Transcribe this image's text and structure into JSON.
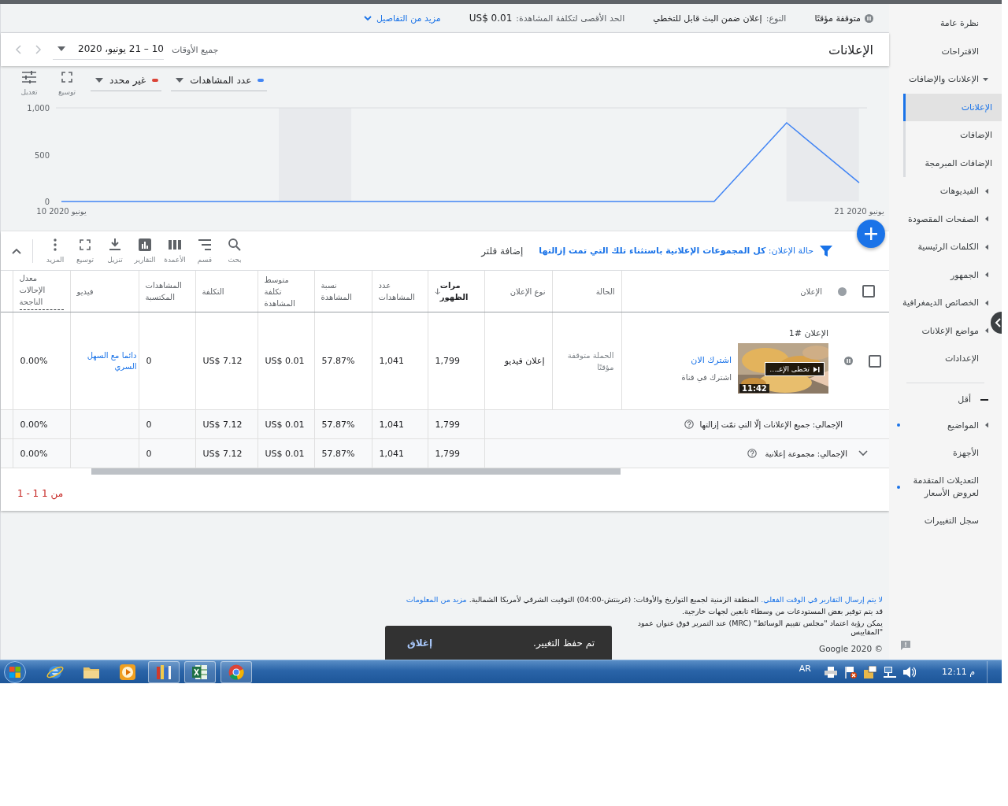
{
  "summary_bar": {
    "paused": true,
    "status": "متوقفة مؤقتًا",
    "type_label": "النوع:",
    "type_value": "إعلان ضمن البث قابل للتخطي",
    "max_cpv_label": "الحد الأقصى لتكلفة المشاهدة:",
    "max_cpv_value": "US$ 0.01",
    "more_details": "مزيد من التفاصيل"
  },
  "page_title": "الإعلانات",
  "date_range": {
    "label": "جميع الأوقات",
    "value": "10 – 21 يونيو، 2020"
  },
  "chart": {
    "metric_selectors": [
      {
        "label": "عدد المشاهدات",
        "color": "#4285f4"
      },
      {
        "label": "غير محدد",
        "color": "#db4437"
      }
    ],
    "tools": [
      {
        "kind": "expand",
        "label": "توسيع"
      },
      {
        "kind": "adjust",
        "label": "تعديل"
      }
    ],
    "chart_data": {
      "type": "line",
      "categories": [
        "10 يونيو 2020",
        null,
        null,
        null,
        null,
        null,
        null,
        null,
        null,
        null,
        null,
        "21 يونيو 2020"
      ],
      "series": [
        {
          "color": "#4285f4",
          "values": [
            0,
            0,
            0,
            0,
            0,
            0,
            0,
            0,
            0,
            0,
            840,
            200
          ]
        }
      ],
      "ylim": [
        0,
        1000
      ],
      "yticks": [
        {
          "value": 0,
          "label": "0"
        },
        {
          "value": 500,
          "label": "500"
        },
        {
          "value": 1000,
          "label": "1,000"
        }
      ]
    }
  },
  "filter_bar": {
    "label": "حالة الإعلان:",
    "value": "كل المجموعات الإعلانية باستثناء تلك التي تمت إزالتها",
    "add_filter": "إضافة فلتر"
  },
  "table_tools": [
    {
      "kind": "search",
      "label": "بحث"
    },
    {
      "kind": "segment",
      "label": "قسم"
    },
    {
      "kind": "columns",
      "label": "الأعمدة"
    },
    {
      "kind": "reports",
      "label": "التقارير"
    },
    {
      "kind": "download",
      "label": "تنزيل"
    },
    {
      "kind": "expand",
      "label": "توسيع"
    },
    {
      "kind": "more",
      "label": "المزيد"
    }
  ],
  "table": {
    "select_all_checked": false,
    "columns": [
      {
        "label": "الإعلان",
        "sorted": false,
        "underlined": false
      },
      {
        "label": "الحالة",
        "sorted": false,
        "underlined": false
      },
      {
        "label": "نوع الإعلان",
        "sorted": false,
        "underlined": false
      },
      {
        "label": "مرات الظهور",
        "sorted": true,
        "underlined": false
      },
      {
        "label": "عدد المشاهدات",
        "sorted": false,
        "underlined": false
      },
      {
        "label": "نسبة المشاهدة",
        "sorted": false,
        "underlined": false
      },
      {
        "label": "متوسط تكلفة المشاهدة",
        "sorted": false,
        "underlined": false
      },
      {
        "label": "التكلفة",
        "sorted": false,
        "underlined": false
      },
      {
        "label": "المشاهدات المكتسبة",
        "sorted": false,
        "underlined": false
      },
      {
        "label": "فيديو",
        "sorted": false,
        "underlined": false
      },
      {
        "label": "معدل الإحالات الناجحة",
        "sorted": false,
        "underlined": true
      }
    ],
    "rows": [
      {
        "checked": false,
        "paused": true,
        "name": "الإعلان #1",
        "video_title": "تخطى الإعـ…",
        "duration": "11:42",
        "headline": "اشترك الان",
        "description": "اشترك في قناة",
        "status": "الحملة متوقفة مؤقتًا",
        "ad_type": "إعلان فيديو",
        "impressions": "1,799",
        "views": "1,041",
        "view_rate": "57.87%",
        "avg_cpv": "US$ 0.01",
        "cost": "US$ 7.12",
        "earned_views": "0",
        "video": "دائما مع السهل السري",
        "conversion_rate": "0.00%"
      }
    ],
    "totals": [
      {
        "label": "الإجمالي: جميع الإعلانات إلّا التي تمّت إزالتها",
        "expandable": false,
        "impressions": "1,799",
        "views": "1,041",
        "view_rate": "57.87%",
        "avg_cpv": "US$ 0.01",
        "cost": "US$ 7.12",
        "earned_views": "0",
        "conversion_rate": "0.00%"
      },
      {
        "label": "الإجمالي: مجموعة إعلانية",
        "expandable": true,
        "impressions": "1,799",
        "views": "1,041",
        "view_rate": "57.87%",
        "avg_cpv": "US$ 0.01",
        "cost": "US$ 7.12",
        "earned_views": "0",
        "conversion_rate": "0.00%"
      }
    ],
    "pagination": "1 - 1 من 1"
  },
  "footer": {
    "notes": [
      {
        "parts": [
          {
            "text": "لا يتم إرسال التقارير في الوقت الفعلي.",
            "link": true
          },
          {
            "text": " المنطقة الزمنية لجميع التواريخ والأوقات: (غرينتش-04:00) التوقيت الشرقي لأمريكا الشمالية. ",
            "link": false
          },
          {
            "text": "مزيد من المعلومات",
            "link": true
          }
        ]
      },
      {
        "parts": [
          {
            "text": "قد يتم توفير بعض المستودعات من وسطاء تابعين لجهات خارجية.",
            "link": false
          }
        ]
      },
      {
        "parts": [
          {
            "text": "يمكن رؤية اعتماد \"مجلس تقييم الوسائط\" (MRC) عند التمرير فوق عنوان عمود \"المقاييس",
            "link": false
          }
        ]
      }
    ],
    "copyright": "© Google 2020"
  },
  "snackbar": {
    "message": "تم حفظ التغيير.",
    "action": "إغلاق"
  },
  "sidebar": {
    "items": [
      {
        "label": "نظرة عامة",
        "kind": "link",
        "selected": false,
        "marked": false
      },
      {
        "label": "الاقتراحات",
        "kind": "link",
        "selected": false,
        "marked": false
      },
      {
        "label": "الإعلانات والإضافات",
        "kind": "group",
        "expanded": true,
        "selected": false,
        "marked": false,
        "children": [
          {
            "label": "الإعلانات",
            "selected": true
          },
          {
            "label": "الإضافات",
            "selected": false
          },
          {
            "label": "الإضافات المبرمجة",
            "selected": false
          }
        ]
      },
      {
        "label": "الفيديوهات",
        "kind": "group",
        "expanded": false,
        "selected": false,
        "marked": false
      },
      {
        "label": "الصفحات المقصودة",
        "kind": "group",
        "expanded": false,
        "selected": false,
        "marked": false
      },
      {
        "label": "الكلمات الرئيسية",
        "kind": "group",
        "expanded": false,
        "selected": false,
        "marked": false
      },
      {
        "label": "الجمهور",
        "kind": "group",
        "expanded": false,
        "selected": false,
        "marked": false
      },
      {
        "label": "الخصائص الديمغرافية",
        "kind": "group",
        "expanded": false,
        "selected": false,
        "marked": false
      },
      {
        "label": "مواضع الإعلانات",
        "kind": "group",
        "expanded": false,
        "selected": false,
        "marked": false
      },
      {
        "label": "الإعدادات",
        "kind": "link",
        "selected": false,
        "marked": false
      }
    ],
    "toggle": {
      "label": "أقل",
      "expanded": true
    },
    "more_items": [
      {
        "label": "المواضيع",
        "kind": "group",
        "expanded": false,
        "selected": false,
        "marked": true
      },
      {
        "label": "الأجهزة",
        "kind": "link",
        "selected": false,
        "marked": false
      },
      {
        "label": "التعديلات المتقدمة لعروض الأسعار",
        "kind": "link",
        "selected": false,
        "marked": true
      },
      {
        "label": "سجل التغييرات",
        "kind": "link",
        "selected": false,
        "marked": false
      }
    ]
  },
  "taskbar": {
    "apps": [
      {
        "kind": "ie",
        "open": false
      },
      {
        "kind": "folder",
        "open": false
      },
      {
        "kind": "media",
        "open": false
      },
      {
        "kind": "books",
        "open": true
      },
      {
        "kind": "excel",
        "open": true
      },
      {
        "kind": "chrome",
        "open": true
      }
    ],
    "language": "AR",
    "clock": "12:11 م"
  }
}
